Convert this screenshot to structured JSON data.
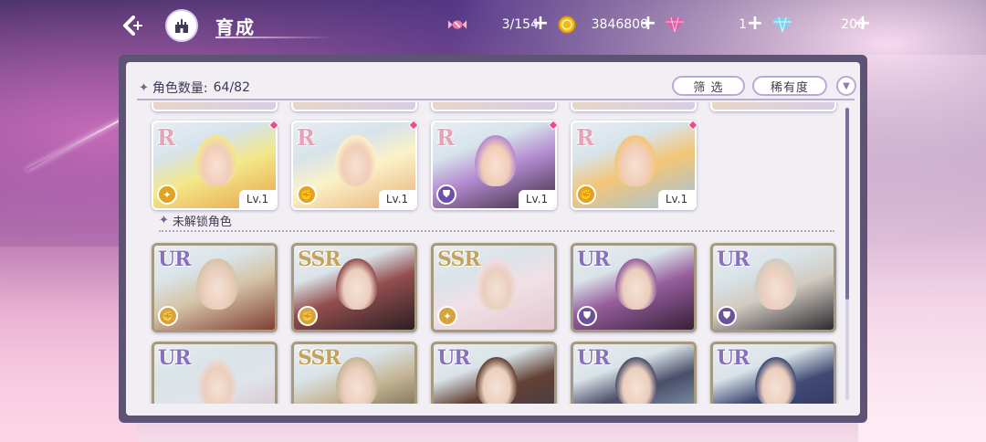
{
  "header": {
    "title": "育成",
    "back_icon": "back-arrow-icon",
    "home_icon": "castle-home-icon"
  },
  "resources": [
    {
      "icon": "candy-icon",
      "value": "3/154"
    },
    {
      "icon": "gold-coin-icon",
      "value": "3846800"
    },
    {
      "icon": "pink-gem-icon",
      "value": "1"
    },
    {
      "icon": "blue-diamond-icon",
      "value": "200"
    }
  ],
  "panel": {
    "count_label": "角色数量:",
    "count_value": "64/82",
    "filter_label": "筛 选",
    "rarity_label": "稀有度",
    "locked_section_title": "未解锁角色"
  },
  "unlocked_cards": [
    {
      "rarity": "R",
      "level": "Lv.1",
      "role": "gold",
      "role_icon": "wand-icon",
      "colors": [
        "#f3e88a",
        "#e8a34a"
      ]
    },
    {
      "rarity": "R",
      "level": "Lv.1",
      "role": "gold",
      "role_icon": "fist-icon",
      "colors": [
        "#fbf2c8",
        "#e9b07a"
      ]
    },
    {
      "rarity": "R",
      "level": "Lv.1",
      "role": "purple",
      "role_icon": "shield-icon",
      "colors": [
        "#b38ad0",
        "#3a2b3c"
      ]
    },
    {
      "rarity": "R",
      "level": "Lv.1",
      "role": "gold",
      "role_icon": "fist-icon",
      "colors": [
        "#f3c677",
        "#9fc2e0"
      ]
    }
  ],
  "locked_cards": [
    {
      "rarity": "UR",
      "role": "gold",
      "role_icon": "fist-icon",
      "colors": [
        "#d9c3a0",
        "#8b3b2e"
      ]
    },
    {
      "rarity": "SSR",
      "role": "gold",
      "role_icon": "fist-icon",
      "colors": [
        "#a04a4a",
        "#2e1e24"
      ]
    },
    {
      "rarity": "SSR",
      "role": "gold",
      "role_icon": "wand-icon",
      "colors": [
        "#f3dfe6",
        "#e9c6d0"
      ]
    },
    {
      "rarity": "UR",
      "role": "purple",
      "role_icon": "shield-icon",
      "colors": [
        "#a05aa8",
        "#3a1e3c"
      ]
    },
    {
      "rarity": "UR",
      "role": "purple",
      "role_icon": "shield-icon",
      "colors": [
        "#d2cbc0",
        "#2e2a30"
      ]
    },
    {
      "rarity": "UR",
      "role": "gold",
      "role_icon": "wand-icon",
      "colors": [
        "#dfe4ea",
        "#e0b6c8"
      ]
    },
    {
      "rarity": "SSR",
      "role": "gold",
      "role_icon": "wand-icon",
      "colors": [
        "#c9b58e",
        "#5e5030"
      ]
    },
    {
      "rarity": "UR",
      "role": "purple",
      "role_icon": "shield-icon",
      "colors": [
        "#6a4030",
        "#3a3a4e"
      ]
    },
    {
      "rarity": "UR",
      "role": "gold",
      "role_icon": "fist-icon",
      "colors": [
        "#4a4e6e",
        "#8fb0d0"
      ]
    },
    {
      "rarity": "UR",
      "role": "purple",
      "role_icon": "shield-icon",
      "colors": [
        "#3e4a7e",
        "#2a3068"
      ]
    }
  ],
  "colors": {
    "panel_frame": "#5e5375",
    "panel_bg": "#f1eef4",
    "accent": "#b9a9d4",
    "new_badge": "#e84d8a"
  }
}
